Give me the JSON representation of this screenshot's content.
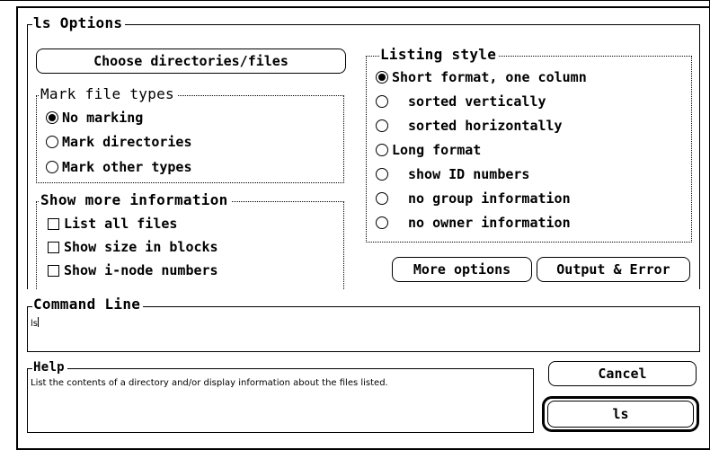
{
  "dialog": {
    "title": "ls Options",
    "choose_button": "Choose directories/files",
    "mark_types": {
      "title": "Mark file types",
      "options": [
        {
          "label": "No marking",
          "selected": true
        },
        {
          "label": "Mark directories",
          "selected": false
        },
        {
          "label": "Mark other types",
          "selected": false
        }
      ]
    },
    "more_info": {
      "title": "Show more information",
      "options": [
        {
          "label": "List all files",
          "checked": false
        },
        {
          "label": "Show size in blocks",
          "checked": false
        },
        {
          "label": "Show i-node numbers",
          "checked": false
        }
      ]
    },
    "listing_style": {
      "title": "Listing style",
      "options": [
        {
          "label": "Short format, one column",
          "selected": true
        },
        {
          "label": "sorted vertically",
          "selected": false
        },
        {
          "label": "sorted horizontally",
          "selected": false
        },
        {
          "label": "Long format",
          "selected": false
        },
        {
          "label": "show ID numbers",
          "selected": false
        },
        {
          "label": "no group information",
          "selected": false
        },
        {
          "label": "no owner information",
          "selected": false
        }
      ]
    },
    "more_options_button": "More options",
    "output_error_button": "Output & Error",
    "command_line": {
      "title": "Command Line",
      "value": "ls"
    },
    "help": {
      "title": "Help",
      "text": "List the contents of a directory and/or display information about the files listed."
    },
    "cancel_button": "Cancel",
    "ok_button": "ls"
  }
}
